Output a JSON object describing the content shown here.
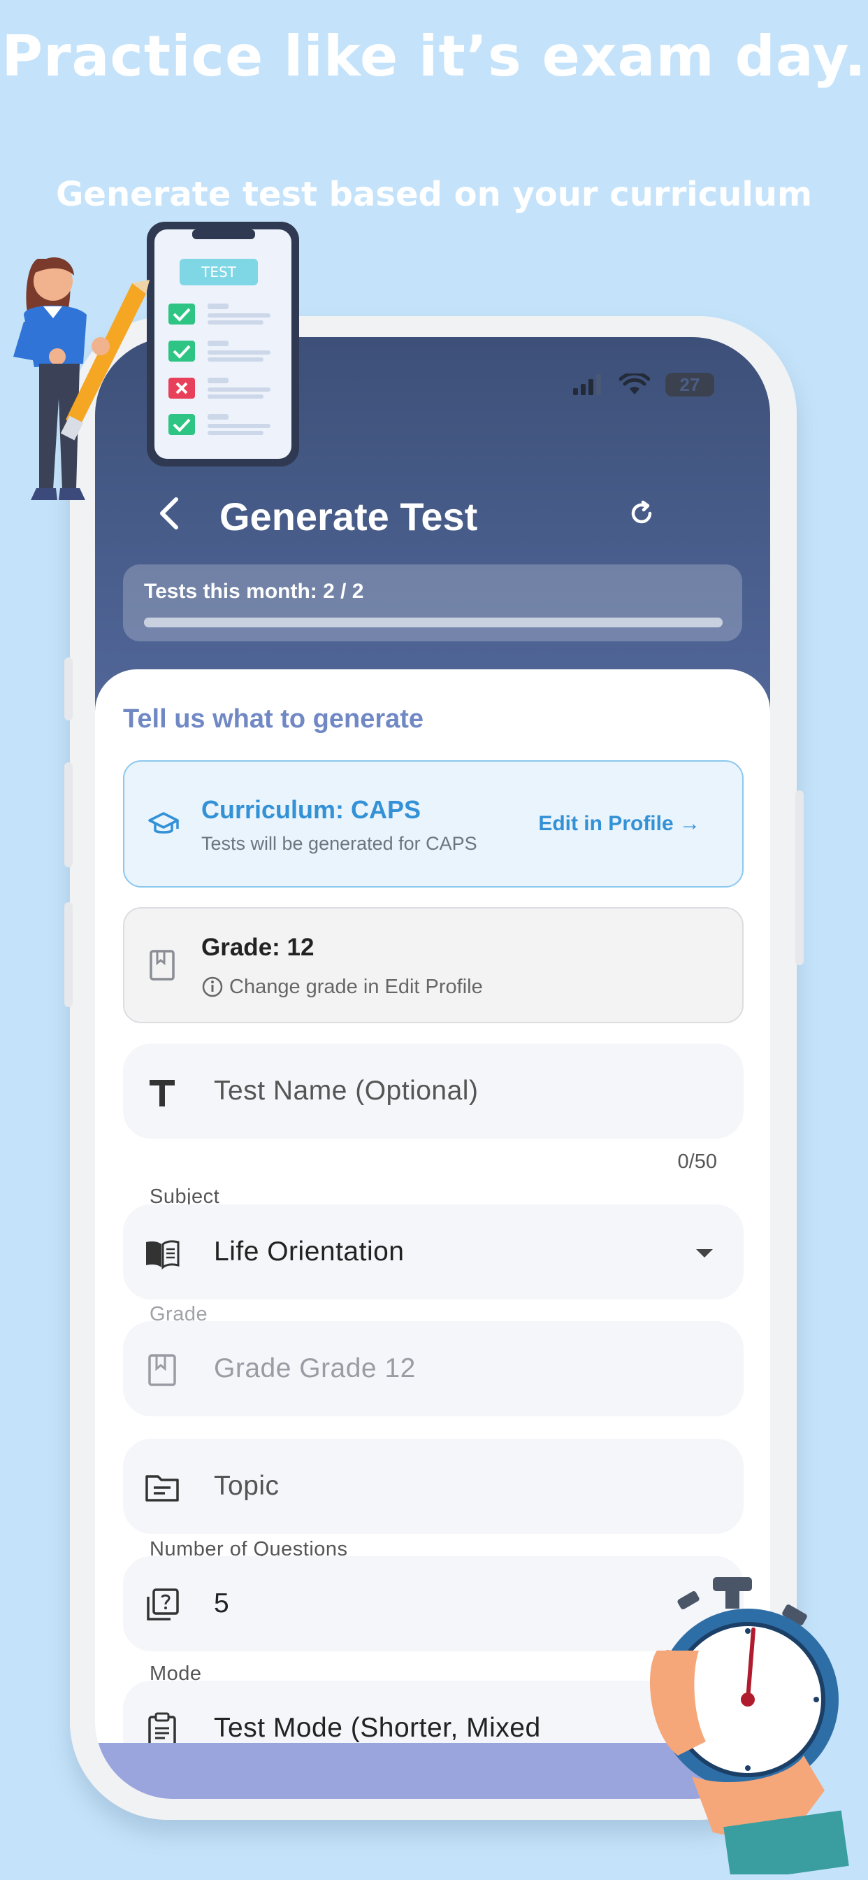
{
  "promo": {
    "headline": "Practice like it’s exam day.",
    "subheadline": "Generate test based on your curriculum",
    "test_badge": "TEST"
  },
  "status_bar": {
    "battery": "27"
  },
  "header": {
    "title": "Generate Test"
  },
  "quota": {
    "label": "Tests this month: 2 / 2",
    "used": 2,
    "limit": 2
  },
  "form": {
    "section_title": "Tell us what to generate",
    "curriculum": {
      "title": "Curriculum: CAPS",
      "subtitle": "Tests will be generated for CAPS",
      "link": "Edit in Profile →"
    },
    "grade_card": {
      "title": "Grade: 12",
      "hint": "Change grade in Edit Profile"
    },
    "test_name": {
      "placeholder": "Test Name (Optional)",
      "counter": "0/50"
    },
    "subject": {
      "label": "Subject",
      "value": "Life Orientation"
    },
    "grade_field": {
      "label": "Grade",
      "value": "Grade Grade 12"
    },
    "topic": {
      "placeholder": "Topic"
    },
    "questions": {
      "label": "Number of Questions",
      "value": "5"
    },
    "mode": {
      "label": "Mode",
      "value": "Test Mode (Shorter, Mixed"
    }
  },
  "colors": {
    "background": "#c4e3fa",
    "header_top": "#3d5079",
    "header_bottom": "#52689a",
    "accent_blue": "#3391d6",
    "section_title": "#7088c4"
  }
}
